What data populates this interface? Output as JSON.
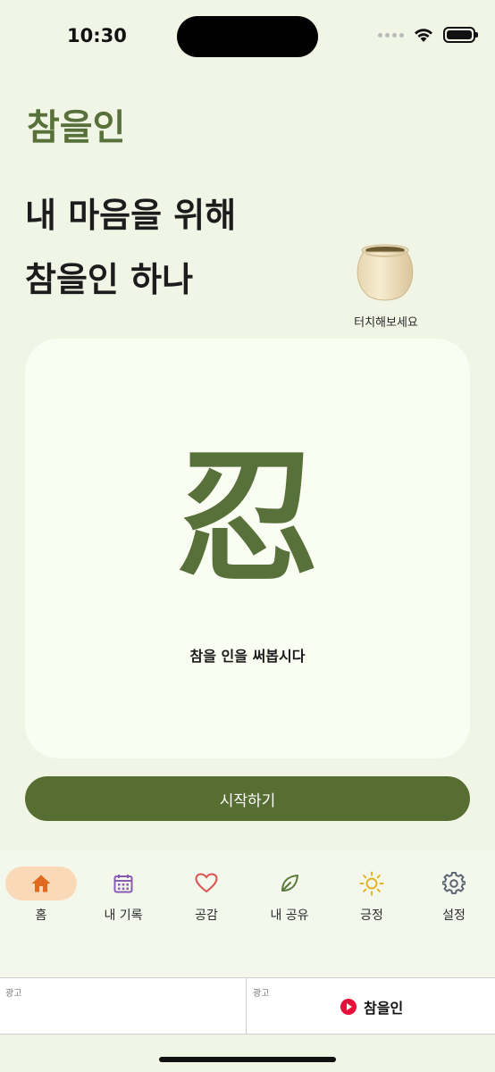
{
  "status": {
    "time": "10:30"
  },
  "app": {
    "title": "참을인"
  },
  "headline": {
    "line1": "내 마음을 위해",
    "line2": "참을인 하나"
  },
  "jar": {
    "caption": "터치해보세요",
    "icon": "jar-icon"
  },
  "card": {
    "kanji": "忍",
    "caption": "참을 인을 써봅시다"
  },
  "start_button": {
    "label": "시작하기"
  },
  "tabs": [
    {
      "label": "홈",
      "icon": "home-icon",
      "color": "#e06a1f",
      "active": true
    },
    {
      "label": "내 기록",
      "icon": "calendar-icon",
      "color": "#8a5bb5",
      "active": false
    },
    {
      "label": "공감",
      "icon": "heart-icon",
      "color": "#d9534f",
      "active": false
    },
    {
      "label": "내 공유",
      "icon": "leaf-icon",
      "color": "#5a7a3a",
      "active": false
    },
    {
      "label": "긍정",
      "icon": "sun-icon",
      "color": "#e2b324",
      "active": false
    },
    {
      "label": "설정",
      "icon": "gear-icon",
      "color": "#5b6472",
      "active": false
    }
  ],
  "ads": {
    "left_label": "광고",
    "right_label": "광고",
    "right_brand": "참을인"
  },
  "colors": {
    "accent": "#58703a",
    "background": "#f1f5e6",
    "card": "#fafdf1",
    "button": "#576e32"
  }
}
